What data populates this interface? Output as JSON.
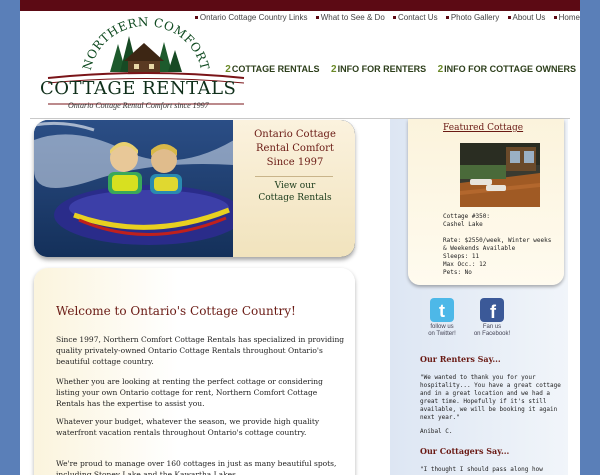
{
  "top_links": [
    "Ontario Cottage Country Links",
    "What to See & Do",
    "Contact Us",
    "Photo Gallery",
    "About Us",
    "Home"
  ],
  "logo": {
    "arc_text": "NORTHERN COMFORT",
    "main_text": "COTTAGE RENTALS",
    "tagline": "Ontario Cottage Rental Comfort since 1997"
  },
  "main_nav": [
    {
      "num": "2",
      "label": "COTTAGE RENTALS"
    },
    {
      "num": "2",
      "label": "INFO FOR RENTERS"
    },
    {
      "num": "2",
      "label": "INFO FOR COTTAGE OWNERS"
    }
  ],
  "hero": {
    "title_lines": [
      "Ontario Cottage",
      "Rental Comfort",
      "Since 1997"
    ],
    "link_lines": [
      "View our",
      "Cottage Rentals"
    ]
  },
  "welcome": {
    "heading": "Welcome to Ontario's Cottage Country!",
    "paragraphs": [
      "Since 1997, Northern Comfort Cottage Rentals has specialized in providing quality privately-owned Ontario Cottage Rentals throughout Ontario's beautiful cottage country.",
      "Whether you are looking at renting the perfect cottage or considering listing your own Ontario cottage for rent, Northern Comfort Cottage Rentals has the expertise to assist you.",
      "Whatever your budget, whatever the season, we provide high quality waterfront vacation rentals throughout Ontario's cottage country.",
      "We're proud to manage over 160 cottages in just as many beautiful spots, including Stoney Lake and the Kawartha Lakes"
    ]
  },
  "featured": {
    "title": "Featured Cottage",
    "lines": [
      "Cottage #350:",
      "Cashel Lake",
      "",
      "Rate: $2550/week, Winter weeks",
      "& Weekends Available",
      "Sleeps: 11",
      "Max Occ.: 12",
      "Pets: No"
    ]
  },
  "social": [
    {
      "icon": "twitter-icon",
      "caption_lines": [
        "follow us",
        "on Twitter!"
      ],
      "color": "#4db8e8"
    },
    {
      "icon": "facebook-icon",
      "caption_lines": [
        "Fan us",
        "on Facebook!"
      ],
      "color": "#3b5998"
    }
  ],
  "renters": {
    "heading": "Our Renters Say...",
    "quote_lines": [
      "\"We wanted to thank you for your",
      "hospitality... You have a great cottage",
      "and in a great location and we had a",
      "great time. Hopefully if it's still",
      "available, we will be booking it again",
      "next year.\""
    ],
    "author": "Anibal C."
  },
  "cottagers": {
    "heading": "Our Cottagers Say...",
    "quote_start": "\"I thought I should pass along how"
  },
  "colors": {
    "brand_maroon": "#5c0a14",
    "heading_red": "#6a1a14",
    "page_background": "#5a7fb8"
  }
}
